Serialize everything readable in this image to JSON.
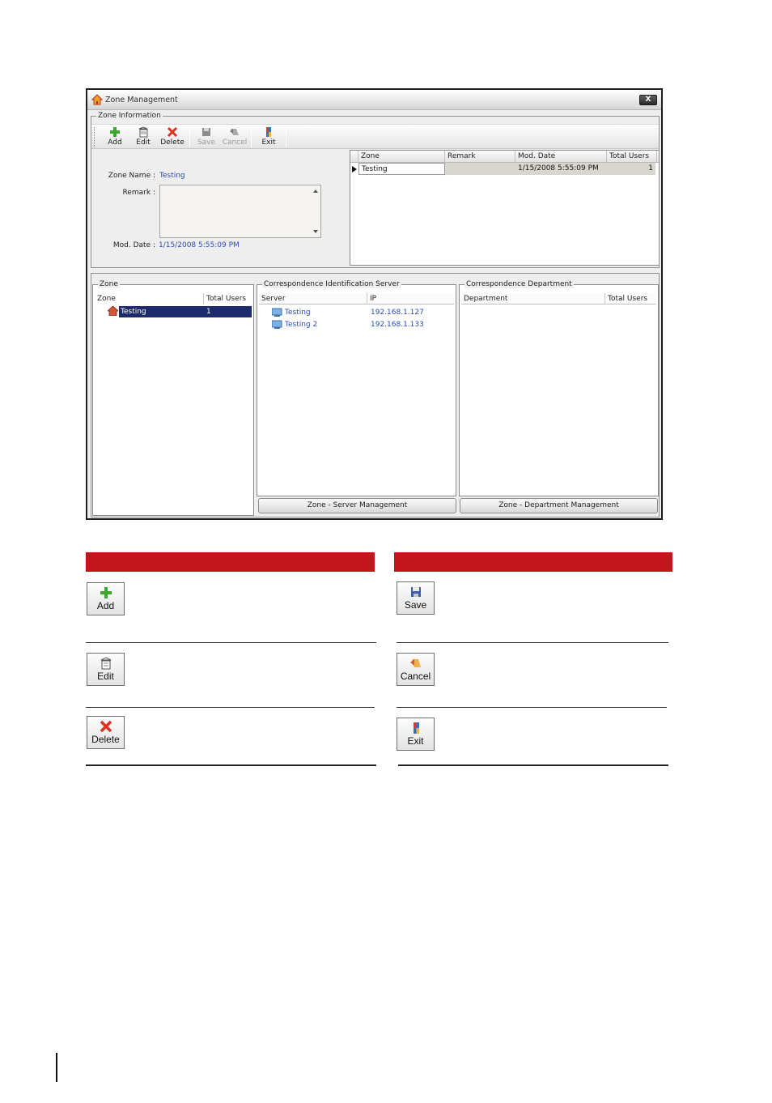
{
  "window": {
    "title": "Zone Management",
    "close_label": "X"
  },
  "zone_information": {
    "group_label": "Zone Information",
    "toolbar": {
      "add": "Add",
      "edit": "Edit",
      "delete": "Delete",
      "save": "Save",
      "cancel": "Cancel",
      "exit": "Exit"
    },
    "form": {
      "zone_name_label": "Zone Name :",
      "zone_name_value": "Testing",
      "remark_label": "Remark :",
      "remark_value": "",
      "mod_date_label": "Mod. Date :",
      "mod_date_value": "1/15/2008 5:55:09 PM"
    },
    "grid": {
      "columns": [
        "Zone",
        "Remark",
        "Mod. Date",
        "Total Users"
      ],
      "rows": [
        {
          "zone": "Testing",
          "remark": "",
          "mod_date": "1/15/2008 5:55:09 PM",
          "total_users": "1"
        }
      ]
    }
  },
  "zone_panel": {
    "title": "Zone",
    "columns": [
      "Zone",
      "Total Users"
    ],
    "rows": [
      {
        "zone": "Testing",
        "total_users": "1"
      }
    ]
  },
  "server_panel": {
    "title": "Correspondence Identification Server",
    "columns": [
      "Server",
      "IP"
    ],
    "rows": [
      {
        "server": "Testing",
        "ip": "192.168.1.127"
      },
      {
        "server": "Testing 2",
        "ip": "192.168.1.133"
      }
    ],
    "button": "Zone - Server Management"
  },
  "department_panel": {
    "title": "Correspondence Department",
    "columns": [
      "Department",
      "Total Users"
    ],
    "rows": [],
    "button": "Zone - Department Management"
  },
  "legend_buttons": {
    "add": "Add",
    "edit": "Edit",
    "delete": "Delete",
    "save": "Save",
    "cancel": "Cancel",
    "exit": "Exit"
  },
  "colors": {
    "header_bar": "#c3161c",
    "selection": "#1c2a6b",
    "value_text": "#2f4bb5"
  }
}
